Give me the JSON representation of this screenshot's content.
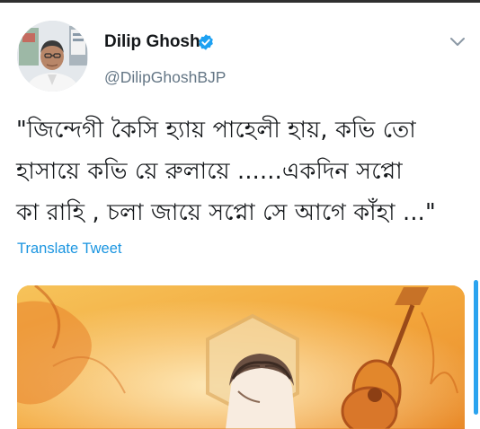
{
  "tweet": {
    "author": {
      "name": "Dilip Ghosh",
      "handle": "@DilipGhoshBJP",
      "verified": true,
      "avatar_icon": "profile-photo"
    },
    "menu_icon": "chevron-down-icon",
    "text": "\"জিন্দেগী কৈসি হ্যায় পাহেলী হায়, কভি তো\nহাসায়ে কভি য়ে  রুলায়ে ......একদিন সপ্নো\nকা রাহি , চলা জায়ে সপ্নো সে আগে কাঁহা ...\"",
    "translate_label": "Translate Tweet",
    "media": {
      "type": "image",
      "description_icon": "illustration-with-guitar"
    }
  },
  "colors": {
    "name": "#14171a",
    "handle": "#657786",
    "link": "#1b95e0",
    "verified": "#1da1f2",
    "media_bg": "#f7b347"
  }
}
